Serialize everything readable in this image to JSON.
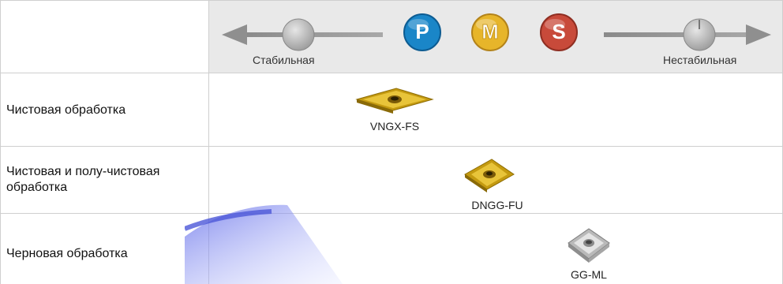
{
  "header": {
    "stable_label": "Стабильная",
    "unstable_label": "Нестабильная",
    "materials": [
      {
        "letter": "P",
        "color": "#1a86c8",
        "icon": "material-p-badge"
      },
      {
        "letter": "M",
        "color": "#e7b52a",
        "icon": "material-m-badge"
      },
      {
        "letter": "S",
        "color": "#c84a3a",
        "icon": "material-s-badge"
      }
    ]
  },
  "rows": [
    {
      "label": "Чистовая обработка",
      "insert": "VNGX-FS",
      "insert_color": "gold"
    },
    {
      "label": "Чистовая и полу-чистовая обработка",
      "insert": "DNGG-FU",
      "insert_color": "gold"
    },
    {
      "label": "Черновая обработка",
      "insert": "GG-ML",
      "insert_color": "silver"
    }
  ]
}
